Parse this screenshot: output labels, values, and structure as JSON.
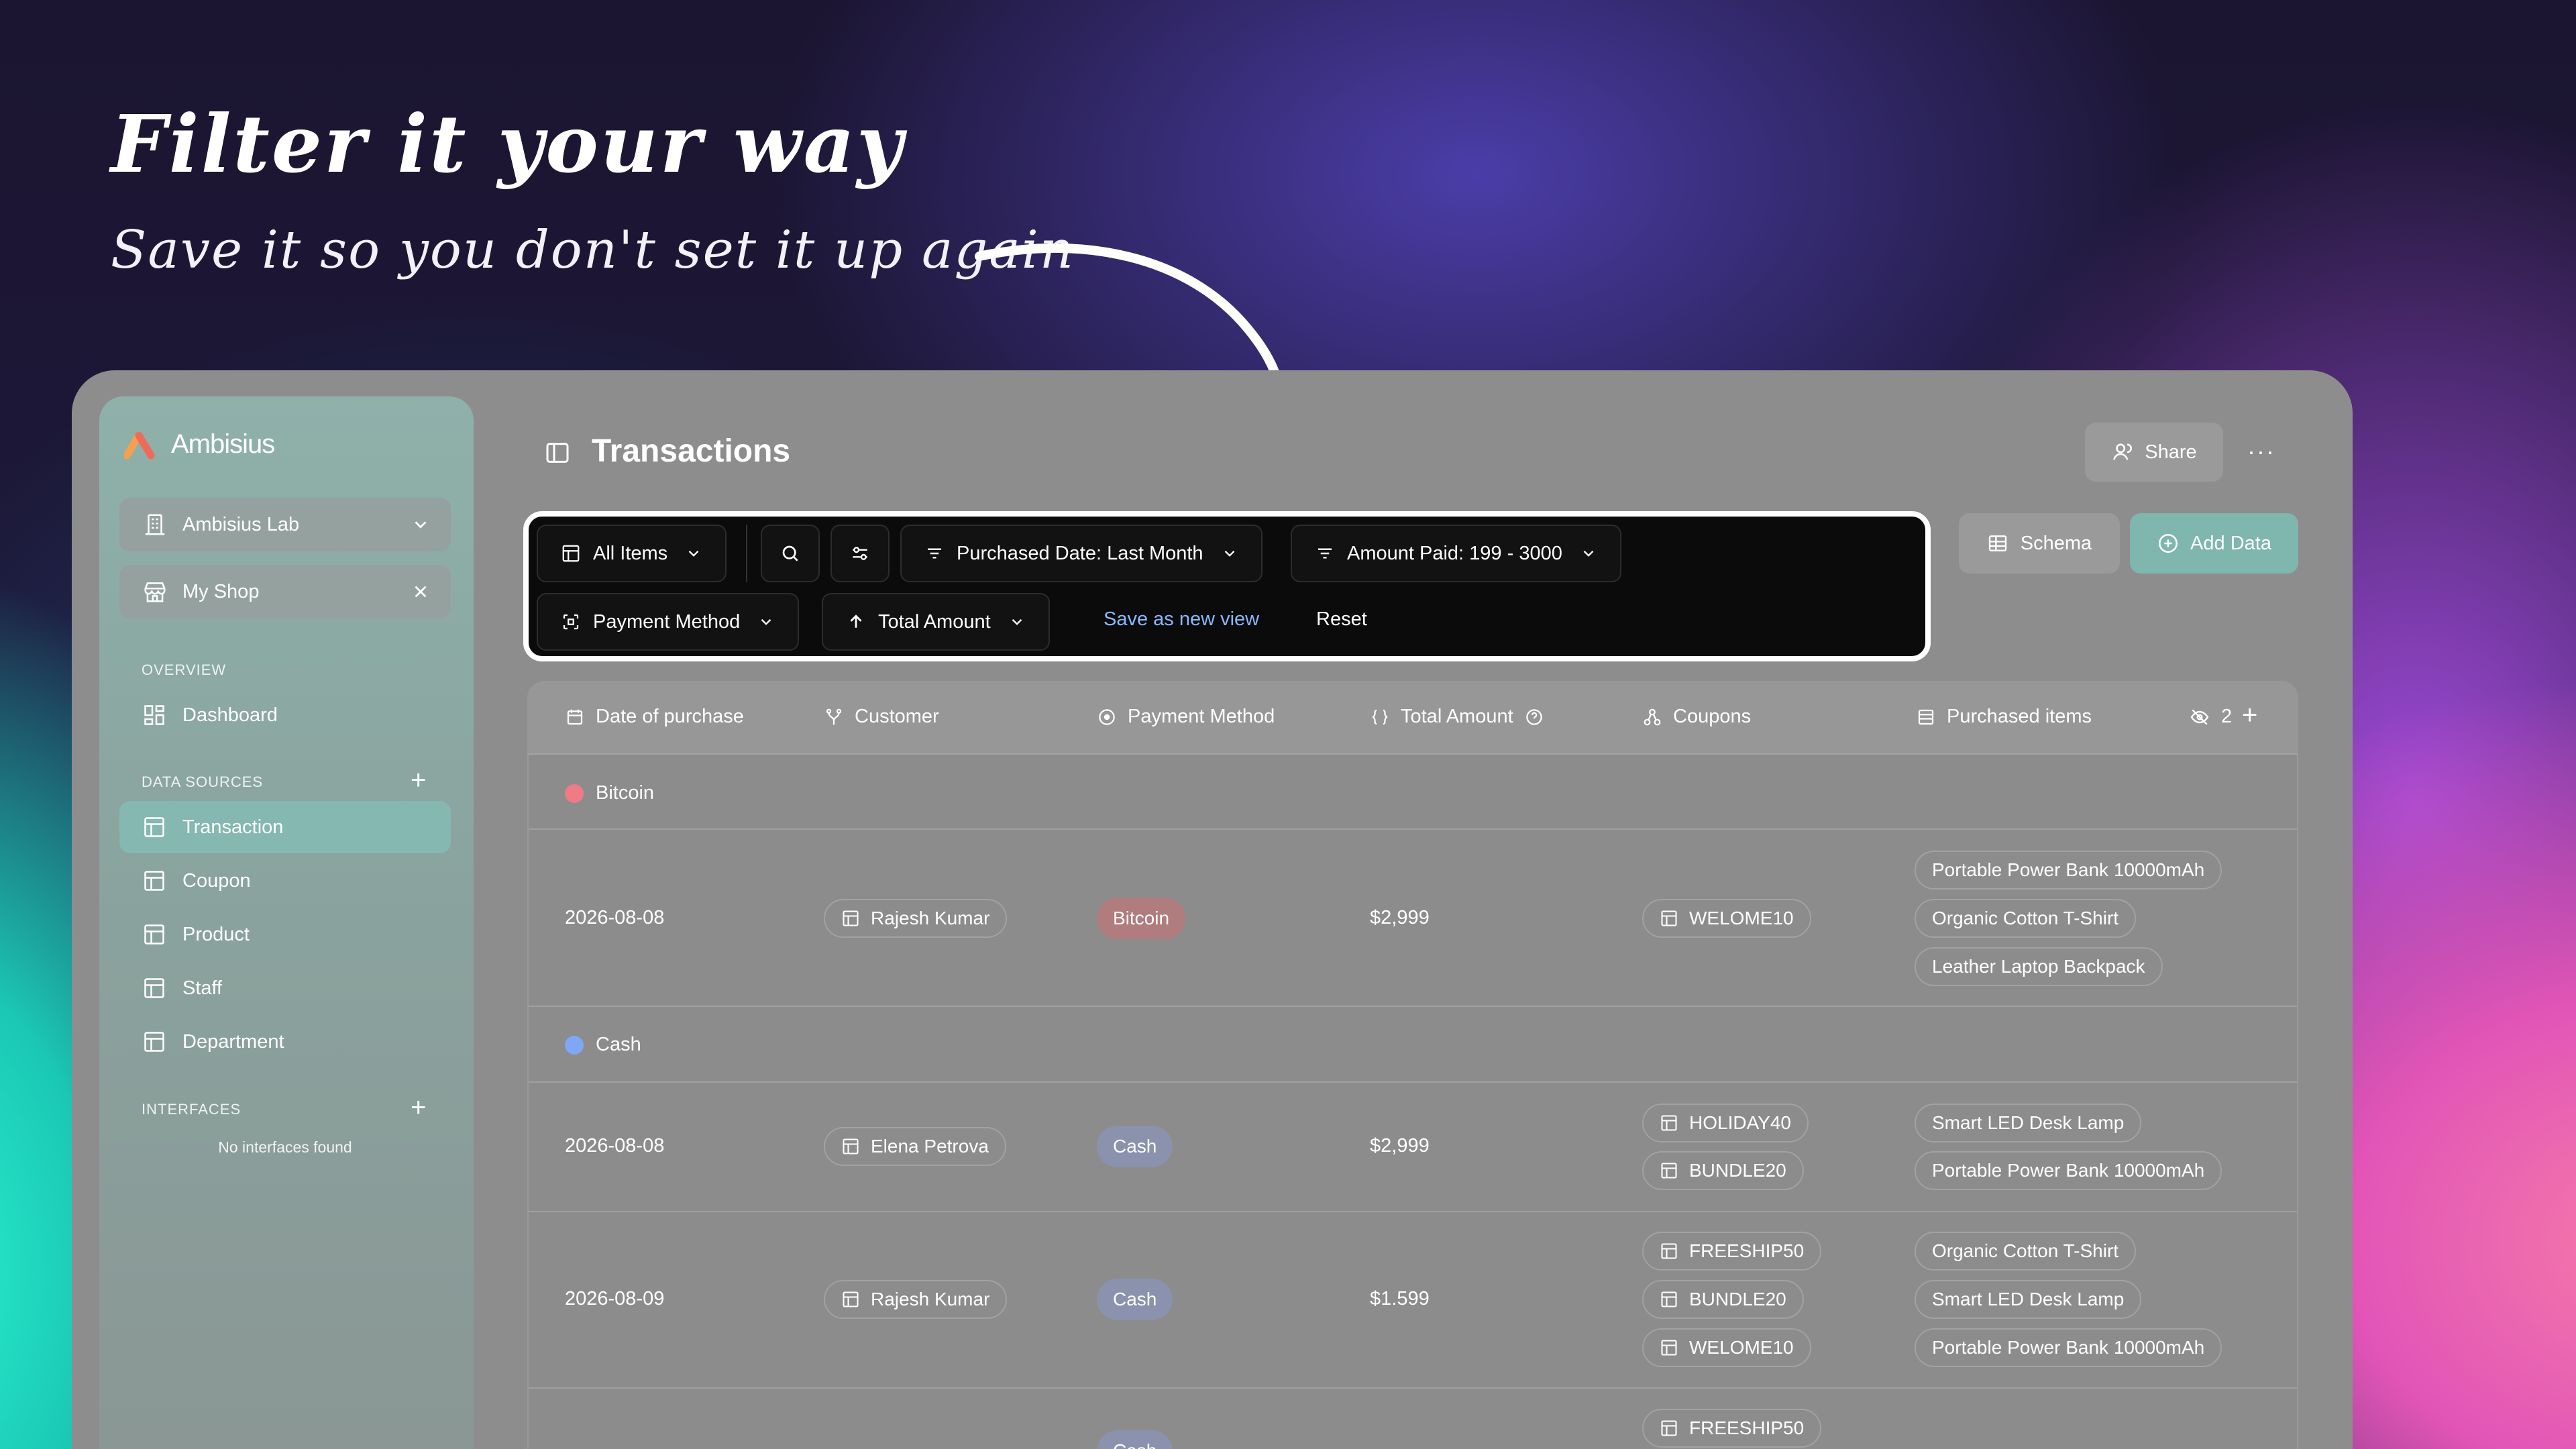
{
  "banner": {
    "heading": "Filter it your way",
    "subheading": "Save it so you don't set it up again"
  },
  "sidebar": {
    "brand": "Ambisius",
    "workspace": "Ambisius Lab",
    "shop": "My Shop",
    "overview_label": "OVERVIEW",
    "overview_items": [
      {
        "label": "Dashboard",
        "icon": "dashboard-icon"
      }
    ],
    "data_sources_label": "DATA SOURCES",
    "data_sources": [
      {
        "label": "Transaction",
        "icon": "table-icon",
        "active": true
      },
      {
        "label": "Coupon",
        "icon": "table-icon"
      },
      {
        "label": "Product",
        "icon": "table-icon"
      },
      {
        "label": "Staff",
        "icon": "table-icon"
      },
      {
        "label": "Department",
        "icon": "table-icon"
      }
    ],
    "interfaces_label": "INTERFACES",
    "interfaces_empty": "No interfaces found"
  },
  "header": {
    "title": "Transactions",
    "share": "Share",
    "more": "···",
    "schema": "Schema",
    "add_data": "Add Data"
  },
  "filters": {
    "view": "All Items",
    "date_filter": "Purchased Date: Last Month",
    "amount_filter": "Amount Paid: 199 - 3000",
    "group_by": "Payment Method",
    "sort": "Total Amount",
    "save_view": "Save as new view",
    "reset": "Reset"
  },
  "table": {
    "columns": [
      "Date of purchase",
      "Customer",
      "Payment Method",
      "Total Amount",
      "Coupons",
      "Purchased items"
    ],
    "hidden_count": "2",
    "groups": [
      {
        "name": "Bitcoin",
        "color": "#f07a86",
        "rows": [
          {
            "date": "2026-08-08",
            "customer": "Rajesh Kumar",
            "method": "Bitcoin",
            "amount": "$2,999",
            "coupons": [
              "WELOME10"
            ],
            "items": [
              "Portable Power Bank 10000mAh",
              "Organic Cotton T-Shirt",
              "Leather Laptop Backpack"
            ]
          }
        ]
      },
      {
        "name": "Cash",
        "color": "#7fa7f5",
        "rows": [
          {
            "date": "2026-08-08",
            "customer": "Elena Petrova",
            "method": "Cash",
            "amount": "$2,999",
            "coupons": [
              "HOLIDAY40",
              "BUNDLE20"
            ],
            "items": [
              "Smart LED Desk Lamp",
              "Portable Power Bank 10000mAh"
            ]
          },
          {
            "date": "2026-08-09",
            "customer": "Rajesh Kumar",
            "method": "Cash",
            "amount": "$1.599",
            "coupons": [
              "FREESHIP50",
              "BUNDLE20",
              "WELOME10"
            ],
            "items": [
              "Organic Cotton T-Shirt",
              "Smart LED Desk Lamp",
              "Portable Power Bank 10000mAh"
            ]
          },
          {
            "date": "",
            "customer": "",
            "method": "Cash",
            "amount": "",
            "coupons": [
              "FREESHIP50"
            ],
            "items": []
          }
        ]
      }
    ]
  },
  "colors": {
    "accent": "#7fb6ad",
    "bitcoin_badge": "#b07c7e",
    "cash_badge": "#8b92ad",
    "link": "#8ab8ff"
  }
}
